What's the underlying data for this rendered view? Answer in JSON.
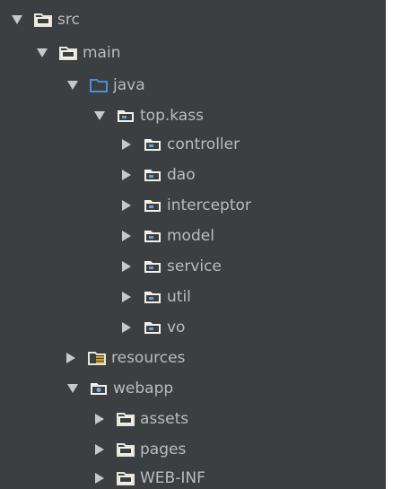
{
  "colors": {
    "background": "#3c3f41",
    "text": "#bbbbbb",
    "arrow": "#c8c8c8",
    "folder": "#f2f0e9",
    "folder_outline": "#e8e4d8",
    "source_folder": "#4d8dd9",
    "package_dot": "#6a9fd4",
    "resources_bars": "#d6a72f",
    "webapp_dot": "#7eaee0"
  },
  "tree": [
    {
      "label": "src",
      "expanded": true,
      "icon": "folder-icon"
    },
    {
      "label": "main",
      "expanded": true,
      "icon": "folder-icon"
    },
    {
      "label": "java",
      "expanded": true,
      "icon": "source-folder-icon"
    },
    {
      "label": "top.kass",
      "expanded": true,
      "icon": "package-folder-icon"
    },
    {
      "label": "controller",
      "expanded": false,
      "icon": "package-folder-icon"
    },
    {
      "label": "dao",
      "expanded": false,
      "icon": "package-folder-icon"
    },
    {
      "label": "interceptor",
      "expanded": false,
      "icon": "package-folder-icon"
    },
    {
      "label": "model",
      "expanded": false,
      "icon": "package-folder-icon"
    },
    {
      "label": "service",
      "expanded": false,
      "icon": "package-folder-icon"
    },
    {
      "label": "util",
      "expanded": false,
      "icon": "package-folder-icon"
    },
    {
      "label": "vo",
      "expanded": false,
      "icon": "package-folder-icon"
    },
    {
      "label": "resources",
      "expanded": false,
      "icon": "resources-folder-icon"
    },
    {
      "label": "webapp",
      "expanded": true,
      "icon": "web-folder-icon"
    },
    {
      "label": "assets",
      "expanded": false,
      "icon": "folder-icon"
    },
    {
      "label": "pages",
      "expanded": false,
      "icon": "folder-icon"
    },
    {
      "label": "WEB-INF",
      "expanded": false,
      "icon": "folder-icon"
    }
  ]
}
